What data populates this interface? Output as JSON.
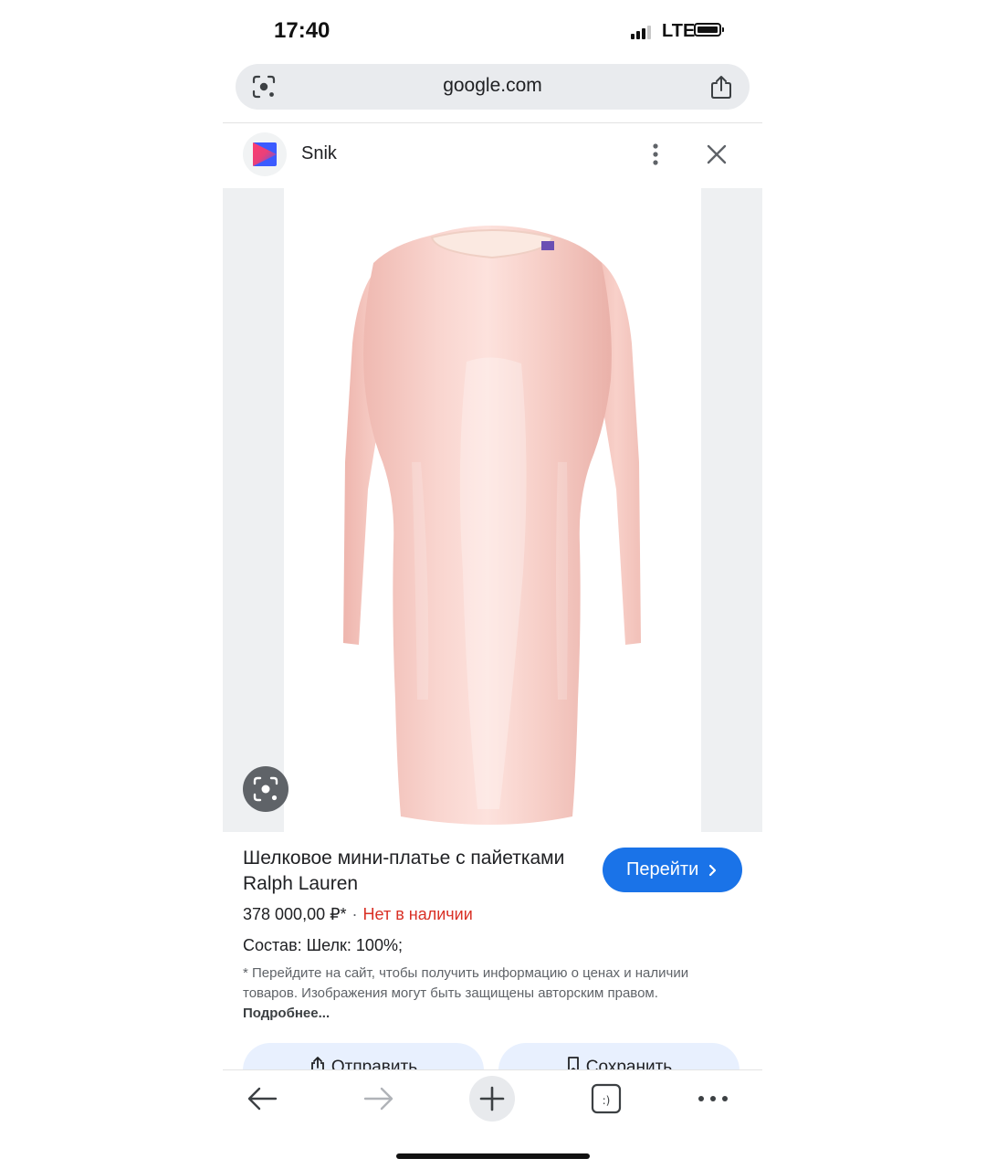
{
  "status": {
    "time": "17:40",
    "network": "LTE"
  },
  "address_bar": {
    "url": "google.com"
  },
  "site": {
    "name": "Snik"
  },
  "product": {
    "title": "Шелковое мини-платье с пайетками Ralph Lauren",
    "go_label": "Перейти",
    "price": "378 000,00 ₽*",
    "separator": "·",
    "availability": "Нет в наличии",
    "composition": "Состав: Шелк: 100%;",
    "disclaimer": "* Перейдите на сайт, чтобы получить информацию о ценах и наличии товаров. Изображения могут быть защищены авторским правом.",
    "more_link": "Подробнее..."
  },
  "actions": {
    "send": "Отправить",
    "save": "Сохранить"
  },
  "colors": {
    "accent": "#1a73e8",
    "out_of_stock": "#d93025",
    "dress": "#f6c9c2"
  },
  "icons": [
    "lens-icon",
    "share-icon",
    "snik-logo-icon",
    "more-vert-icon",
    "close-icon",
    "chevron-right-icon",
    "back-arrow-icon",
    "forward-arrow-icon",
    "plus-icon",
    "tabs-icon",
    "more-horiz-icon"
  ]
}
